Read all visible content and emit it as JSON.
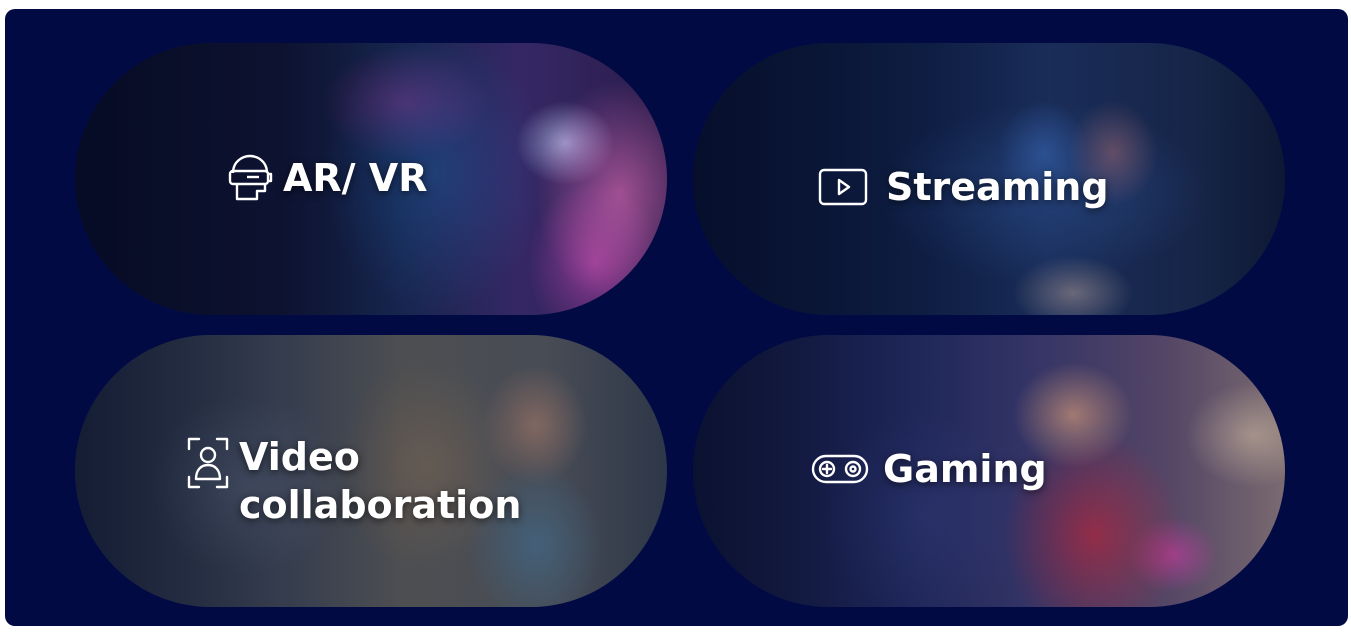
{
  "cards": [
    {
      "id": "ar-vr",
      "label": "AR/ VR",
      "icon": "vr-headset-icon"
    },
    {
      "id": "streaming",
      "label": "Streaming",
      "icon": "play-icon"
    },
    {
      "id": "video-collaboration",
      "label_line1": "Video",
      "label_line2": "collaboration",
      "icon": "user-focus-icon"
    },
    {
      "id": "gaming",
      "label": "Gaming",
      "icon": "gamepad-icon"
    }
  ],
  "colors": {
    "panel_background": "#020a44",
    "label_text": "#ffffff"
  }
}
